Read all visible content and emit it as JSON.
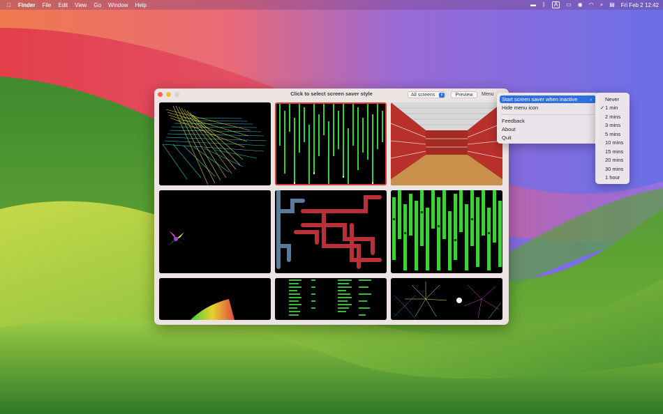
{
  "menubar": {
    "finder": "Finder",
    "items": [
      "File",
      "Edit",
      "View",
      "Go",
      "Window",
      "Help"
    ],
    "input_source": "A",
    "clock": "Fri Feb 2  12:42",
    "icons": [
      "display-icon",
      "bluetooth-icon",
      "input-source-icon",
      "battery-icon",
      "user-icon",
      "wifi-icon",
      "search-icon",
      "control-center-icon"
    ]
  },
  "window": {
    "title": "Click to select screen saver style",
    "screen_select": "All screens",
    "preview_label": "Preview",
    "menu_label": "Menu",
    "thumbnails": [
      "string-art",
      "matrix-rain",
      "maze",
      "butterfly",
      "pipes",
      "green-rain",
      "ribbon",
      "matrix-code",
      "fireworks"
    ],
    "selected_thumbnail": "matrix-rain"
  },
  "menu": {
    "items": [
      "Start screen saver when inactive",
      "Hide menu icon",
      "Feedback",
      "About",
      "Quit"
    ],
    "highlighted": "Start screen saver when inactive"
  },
  "submenu": {
    "items": [
      "Never",
      "1 min",
      "2 mins",
      "3 mins",
      "5 mins",
      "10 mins",
      "15 mins",
      "20 mins",
      "30 mins",
      "1 hour"
    ],
    "checked": "1 min"
  },
  "colors": {
    "accent": "#2f6fe0",
    "selection_border": "#d93a32"
  }
}
